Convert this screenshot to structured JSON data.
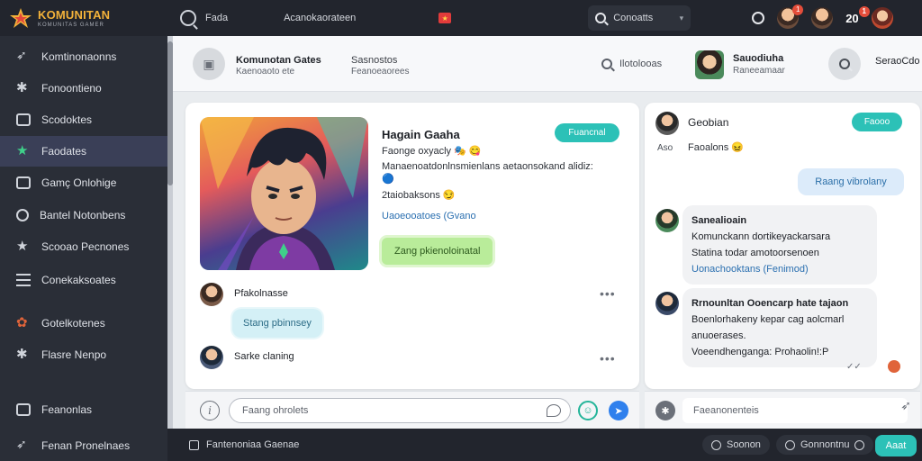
{
  "topbar": {
    "brand_name": "KOMUNITAN",
    "brand_sub": "KOMUNITAS GAMER",
    "nav": [
      "Fada",
      "Acanokaorateen"
    ],
    "search_label": "Conoatts",
    "notif_count": "1",
    "count_label": "20",
    "count_badge": "1"
  },
  "sidebar": {
    "items": [
      {
        "label": "Komtinonaonns",
        "icon": "arrow-icon"
      },
      {
        "label": "Fonoontieno",
        "icon": "gear-icon"
      },
      {
        "label": "Scodoktes",
        "icon": "briefcase-icon"
      },
      {
        "label": "Faodates",
        "icon": "star-icon"
      },
      {
        "label": "Gamç Onlohige",
        "icon": "controller-icon"
      },
      {
        "label": "Bantel Notonbens",
        "icon": "shield-icon"
      },
      {
        "label": "Scooao Pecnones",
        "icon": "trophy-icon"
      },
      {
        "label": "Conekaksoates",
        "icon": "list-icon"
      },
      {
        "label": "Gotelkotenes",
        "icon": "flower-icon"
      },
      {
        "label": "Flasre Nenpo",
        "icon": "cog-icon"
      },
      {
        "label": "Feanonlas",
        "icon": "folder-icon"
      },
      {
        "label": "Fenan Pronelnaes",
        "icon": "arrow-icon"
      }
    ]
  },
  "header": {
    "back_icon": "image-icon",
    "title": "Komunotan Gates",
    "subtitle": "Kaenoaoto ete",
    "title2": "Sasnostos",
    "subtitle2": "Feanoeaorees",
    "search_label": "Ilotolooas",
    "user_name": "Sauodiuha",
    "user_sub": "Raneeamaar",
    "right_label": "SeraoCdo"
  },
  "post": {
    "name": "Hagain Gaaha",
    "tagline": "Faonge oxyacly 🎭 😋",
    "bio": "Manaenoatdonlnsmienlans aetaonsokand alidiz: 🔵",
    "stats": "2taiobaksons 😏",
    "link": "Uaoeooatoes (Gvano",
    "follow_label": "Fuancnal",
    "chip_label": "Zang pkienoloinatal",
    "comments": [
      {
        "name": "Pfakolnasse",
        "bubble": "Stang pbinnsey"
      },
      {
        "name": "Sarke claning"
      }
    ],
    "composer_placeholder": "Faang ohrolets"
  },
  "chat": {
    "name": "Geobian",
    "status_label": "Aso",
    "status": "Faoalons 😖",
    "button_label": "Faooo",
    "outgoing": "Raang vibrolany",
    "bubbles": [
      {
        "title": "Sanealioain",
        "line1": "Komunckann dortikeyackarsara",
        "line2": "Statina todar amotoorsenoen",
        "link": "Uonachooktans (Fenimod)"
      },
      {
        "title": "Rrnounltan Ooencarp hate tajaon",
        "line1": "Boenlorhakeny kepar cag aolcmarl",
        "line2": "anuoerases.",
        "line3": "Voeendhenganga: Prohaolin!:P"
      }
    ],
    "composer_placeholder": "Faeanonenteis"
  },
  "bottombar": {
    "left_label": "Fantenoniaa Gaenae",
    "pill1": "Soonon",
    "pill2": "Gonnontnu",
    "add_label": "Aaat"
  },
  "colors": {
    "accent": "#2cc1b7",
    "dark": "#22252d",
    "sidebar": "#2a2e37",
    "active": "#3a3f57"
  }
}
